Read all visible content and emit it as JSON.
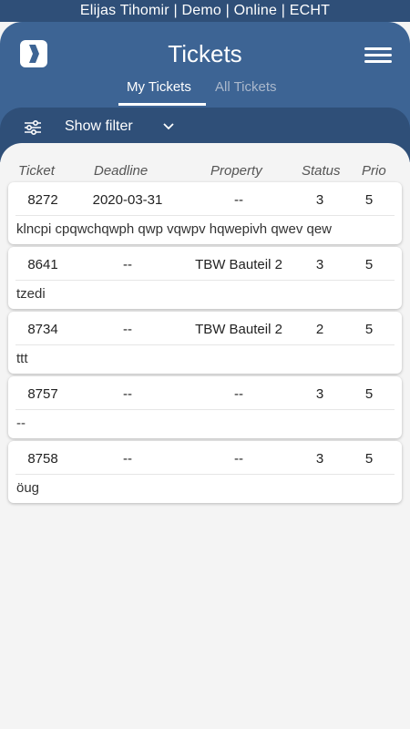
{
  "status_bar": {
    "text": "Elijas Tihomir | Demo | Online | ECHT"
  },
  "header": {
    "title": "Tickets",
    "tabs": [
      {
        "label": "My Tickets",
        "active": true
      },
      {
        "label": "All Tickets",
        "active": false
      }
    ]
  },
  "filter": {
    "label": "Show filter"
  },
  "table": {
    "columns": [
      "Ticket",
      "Deadline",
      "Property",
      "Status",
      "Prio"
    ],
    "rows": [
      {
        "ticket": "8272",
        "deadline": "2020-03-31",
        "property": "--",
        "status": "3",
        "prio": "5",
        "description": "klncpi cpqwchqwph qwp vqwpv hqwepivh qwev qew"
      },
      {
        "ticket": "8641",
        "deadline": "--",
        "property": "TBW Bauteil 2",
        "status": "3",
        "prio": "5",
        "description": "tzedi"
      },
      {
        "ticket": "8734",
        "deadline": "--",
        "property": "TBW Bauteil 2",
        "status": "2",
        "prio": "5",
        "description": "ttt"
      },
      {
        "ticket": "8757",
        "deadline": "--",
        "property": "--",
        "status": "3",
        "prio": "5",
        "description": "--"
      },
      {
        "ticket": "8758",
        "deadline": "--",
        "property": "--",
        "status": "3",
        "prio": "5",
        "description": "öug"
      }
    ]
  },
  "colors": {
    "header_bg": "#3d6494",
    "status_bar_bg": "#2f4f78",
    "filter_bar_bg": "#2f4f78",
    "content_bg": "#f4f4f4"
  },
  "icons": {
    "logo": "app-logo-icon",
    "menu": "hamburger-menu-icon",
    "filter": "filter-sliders-icon",
    "expand": "chevron-down-icon"
  }
}
